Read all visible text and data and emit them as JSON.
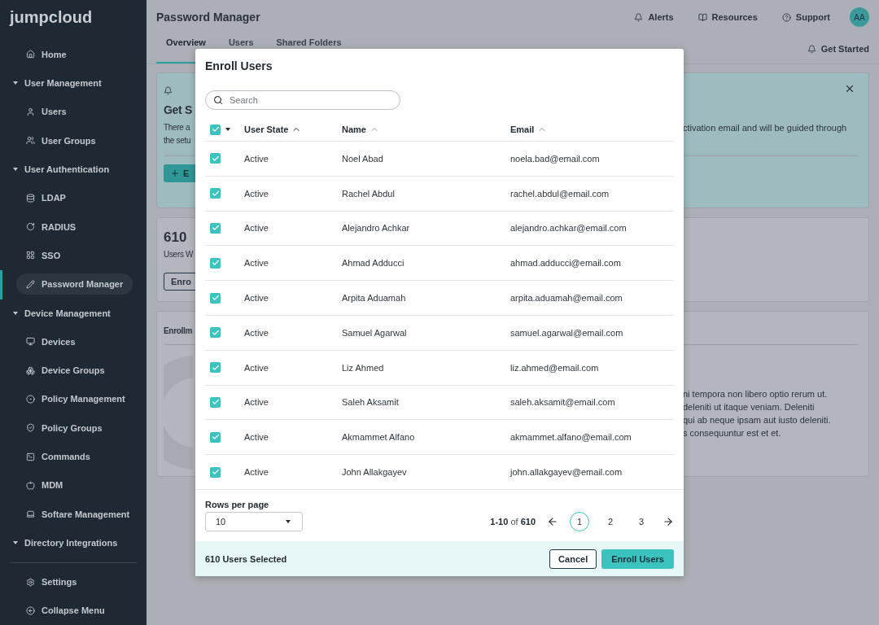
{
  "sidebar": {
    "logo": "jumpcloud",
    "items": [
      {
        "label": "Home",
        "selected": false
      },
      {
        "label": "User Management",
        "expanded": true,
        "children": [
          {
            "label": "Users",
            "selected": false
          },
          {
            "label": "User Groups",
            "selected": false
          }
        ]
      },
      {
        "label": "User Authentication",
        "expanded": true,
        "children": [
          {
            "label": "LDAP",
            "selected": false
          },
          {
            "label": "RADIUS",
            "selected": false
          },
          {
            "label": "SSO",
            "selected": false
          },
          {
            "label": "Password Manager",
            "selected": true
          }
        ]
      },
      {
        "label": "Device Management",
        "expanded": true,
        "children": [
          {
            "label": "Devices",
            "selected": false
          },
          {
            "label": "Device Groups",
            "selected": false
          },
          {
            "label": "Policy Management",
            "selected": false
          },
          {
            "label": "Policy Groups",
            "selected": false
          },
          {
            "label": "Commands",
            "selected": false
          },
          {
            "label": "MDM",
            "selected": false
          },
          {
            "label": "Softare Management",
            "selected": false
          }
        ]
      },
      {
        "label": "Directory Integrations",
        "expanded": true
      }
    ],
    "footer": [
      {
        "label": "Settings"
      },
      {
        "label": "Collapse Menu"
      }
    ]
  },
  "header": {
    "title": "Password Manager",
    "links": [
      {
        "label": "Alerts"
      },
      {
        "label": "Resources"
      },
      {
        "label": "Support"
      }
    ],
    "avatar": "AA"
  },
  "tabs": [
    {
      "label": "Overview",
      "selected": true
    },
    {
      "label": "Users",
      "selected": false
    },
    {
      "label": "Shared Folders",
      "selected": false
    }
  ],
  "get_started_link": "Get Started",
  "get_started_card": {
    "heading": "Get S",
    "lines": [
      "There a",
      "the setu"
    ],
    "right_text": "ctivation email and will be guided through",
    "button": "E"
  },
  "users_card": {
    "count": "610",
    "caption": "Users W",
    "button": "Enro"
  },
  "enrollment_card": {
    "title": "Enrollm",
    "lines": [
      "ni tempora non libero optio rerum ut.",
      "deleniti ut itaque veniam. Deleniti",
      "qui ab neque ipsam aut iusto deleniti.",
      "s consequuntur est et et."
    ]
  },
  "modal": {
    "title": "Enroll Users",
    "search": {
      "placeholder": "Search"
    },
    "select_all": {
      "checked": true
    },
    "columns": [
      {
        "label": "User State"
      },
      {
        "label": "Name"
      },
      {
        "label": "Email"
      }
    ],
    "rows": [
      {
        "state": "Active",
        "name": "Noel Abad",
        "email": "noela.bad@email.com",
        "checked": true
      },
      {
        "state": "Active",
        "name": "Rachel Abdul",
        "email": "rachel.abdul@email.com",
        "checked": true
      },
      {
        "state": "Active",
        "name": "Alejandro Achkar",
        "email": "alejandro.achkar@email.com",
        "checked": true
      },
      {
        "state": "Active",
        "name": "Ahmad Adducci",
        "email": "ahmad.adducci@email.com",
        "checked": true
      },
      {
        "state": "Active",
        "name": "Arpita Aduamah",
        "email": "arpita.aduamah@email.com",
        "checked": true
      },
      {
        "state": "Active",
        "name": "Samuel Agarwal",
        "email": "samuel.agarwal@email.com",
        "checked": true
      },
      {
        "state": "Active",
        "name": "Liz Ahmed",
        "email": "liz.ahmed@email.com",
        "checked": true
      },
      {
        "state": "Active",
        "name": "Saleh Aksamit",
        "email": "saleh.aksamit@email.com",
        "checked": true
      },
      {
        "state": "Active",
        "name": "Akmammet Alfano",
        "email": "akmammet.alfano@email.com",
        "checked": true
      },
      {
        "state": "Active",
        "name": "John Allakgayev",
        "email": "john.allakgayev@email.com",
        "checked": true
      }
    ],
    "rows_per_page_label": "Rows per page",
    "rows_per_page": "10",
    "range": "**1-10** of **610**",
    "pages": [
      {
        "label": "1",
        "selected": true
      },
      {
        "label": "2",
        "selected": false
      },
      {
        "label": "3",
        "selected": false
      }
    ],
    "selected_count": "610 Users Selected",
    "cancel": "Cancel",
    "submit": "Enroll Users"
  }
}
